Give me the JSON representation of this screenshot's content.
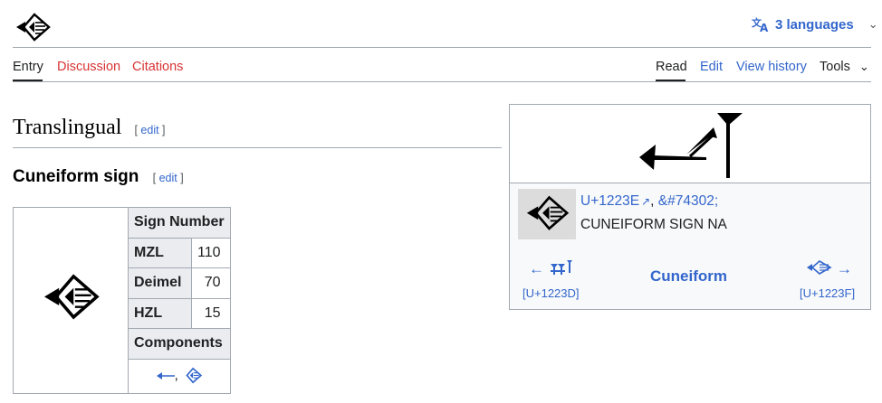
{
  "header": {
    "logo_icon": "cuneiform-sign-na-icon",
    "languages_label": "3 languages",
    "translate_icon": "translate-icon",
    "chevron_icon": "chevron-down-icon"
  },
  "tabs_left": [
    "Entry",
    "Discussion",
    "Citations"
  ],
  "tabs_right": {
    "read": "Read",
    "edit": "Edit",
    "history": "View history",
    "tools": "Tools"
  },
  "section": {
    "language_heading": "Translingual",
    "language_edit": "edit",
    "pos_heading": "Cuneiform sign",
    "pos_edit": "edit"
  },
  "sign_table": {
    "header": "Sign Number",
    "rows": [
      {
        "label": "MZL",
        "value": "110"
      },
      {
        "label": "Deimel",
        "value": "70"
      },
      {
        "label": "HZL",
        "value": "15"
      }
    ],
    "components_header": "Components",
    "components_separator": ","
  },
  "infobox": {
    "codepoint": "U+1223E",
    "entity": "&#74302;",
    "name": "CUNEIFORM SIGN NA",
    "prev_codepoint": "[U+1223D]",
    "next_codepoint": "[U+1223F]",
    "prev_arrow": "←",
    "next_arrow": "→",
    "script": "Cuneiform",
    "comma": ","
  },
  "colors": {
    "link": "#3366cc",
    "redlink": "#d73333",
    "border": "#a2a9b1",
    "table_header_bg": "#eaecf0"
  }
}
